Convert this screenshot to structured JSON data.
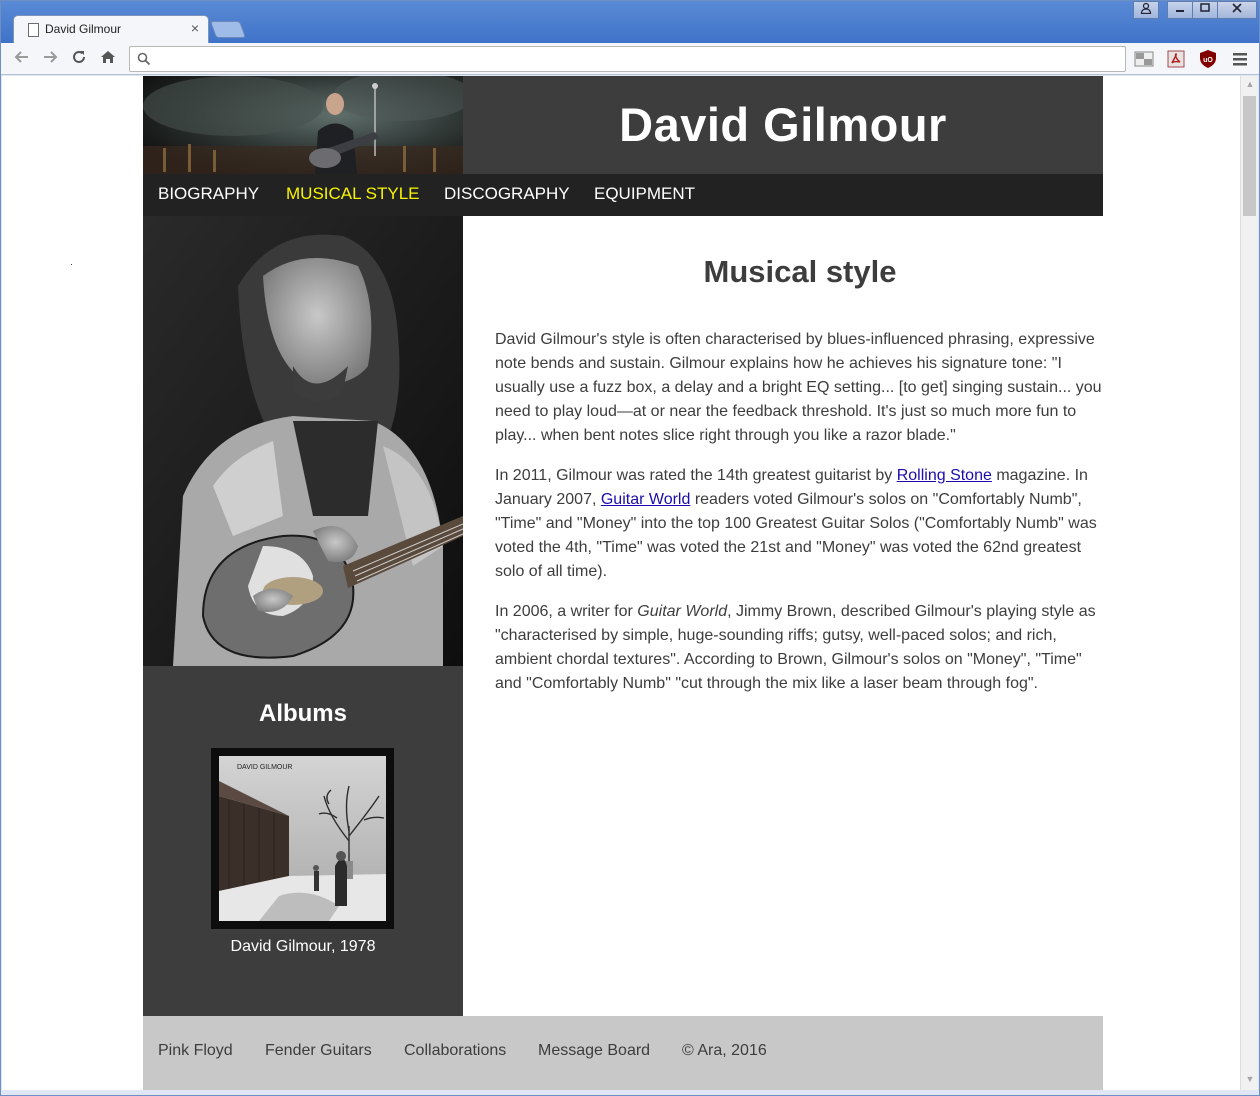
{
  "browser": {
    "tab_title": "David Gilmour",
    "tab_close": "×",
    "window_controls": [
      "person-icon",
      "minimize-icon",
      "maximize-icon",
      "close-icon"
    ],
    "nav_icons": [
      "back-icon",
      "forward-icon",
      "reload-icon",
      "home-icon"
    ],
    "omnibox_value": "",
    "extensions": [
      "screen-extension-icon",
      "pdf-extension-icon",
      "ublock-shield-icon",
      "menu-icon"
    ]
  },
  "site": {
    "title": "David Gilmour",
    "nav": [
      {
        "label": "BIOGRAPHY"
      },
      {
        "label": "MUSICAL STYLE",
        "active": true
      },
      {
        "label": "DISCOGRAPHY"
      },
      {
        "label": "EQUIPMENT"
      }
    ],
    "page_heading": "Musical style",
    "paragraphs": {
      "p1": "David Gilmour's style is often characterised by blues-influenced phrasing, expressive note bends and sustain. Gilmour explains how he achieves his signature tone: \"I usually use a fuzz box, a delay and a bright EQ setting... [to get] singing sustain... you need to play loud—at or near the feedback threshold. It's just so much more fun to play... when bent notes slice right through you like a razor blade.\"",
      "p2_a": "In 2011, Gilmour was rated the 14th greatest guitarist by ",
      "p2_link1": "Rolling Stone",
      "p2_b": " magazine. In January 2007, ",
      "p2_link2": "Guitar World",
      "p2_c": " readers voted Gilmour's solos on \"Comfortably Numb\", \"Time\" and \"Money\" into the top 100 Greatest Guitar Solos (\"Comfortably Numb\" was voted the 4th, \"Time\" was voted the 21st and \"Money\" was voted the 62nd greatest solo of all time).",
      "p3_a": "In 2006, a writer for ",
      "p3_em": "Guitar World",
      "p3_b": ", Jimmy Brown, described Gilmour's playing style as \"characterised by simple, huge-sounding riffs; gutsy, well-paced solos; and rich, ambient chordal textures\". According to Brown, Gilmour's solos on \"Money\", \"Time\" and \"Comfortably Numb\" \"cut through the mix like a laser beam through fog\"."
    },
    "sidebar": {
      "albums_title": "Albums",
      "album_cover_text": "DAVID GILMOUR",
      "album_caption": "David Gilmour, 1978"
    },
    "footer": [
      {
        "label": "Pink Floyd"
      },
      {
        "label": "Fender Guitars"
      },
      {
        "label": "Collaborations"
      },
      {
        "label": "Message Board"
      },
      {
        "label": "© Ara, 2016"
      }
    ]
  },
  "colors": {
    "header_bg": "#3d3d3d",
    "nav_bg": "#222222",
    "nav_active": "#f7f500",
    "footer_bg": "#c8c8c8",
    "link": "#1a0dab"
  }
}
